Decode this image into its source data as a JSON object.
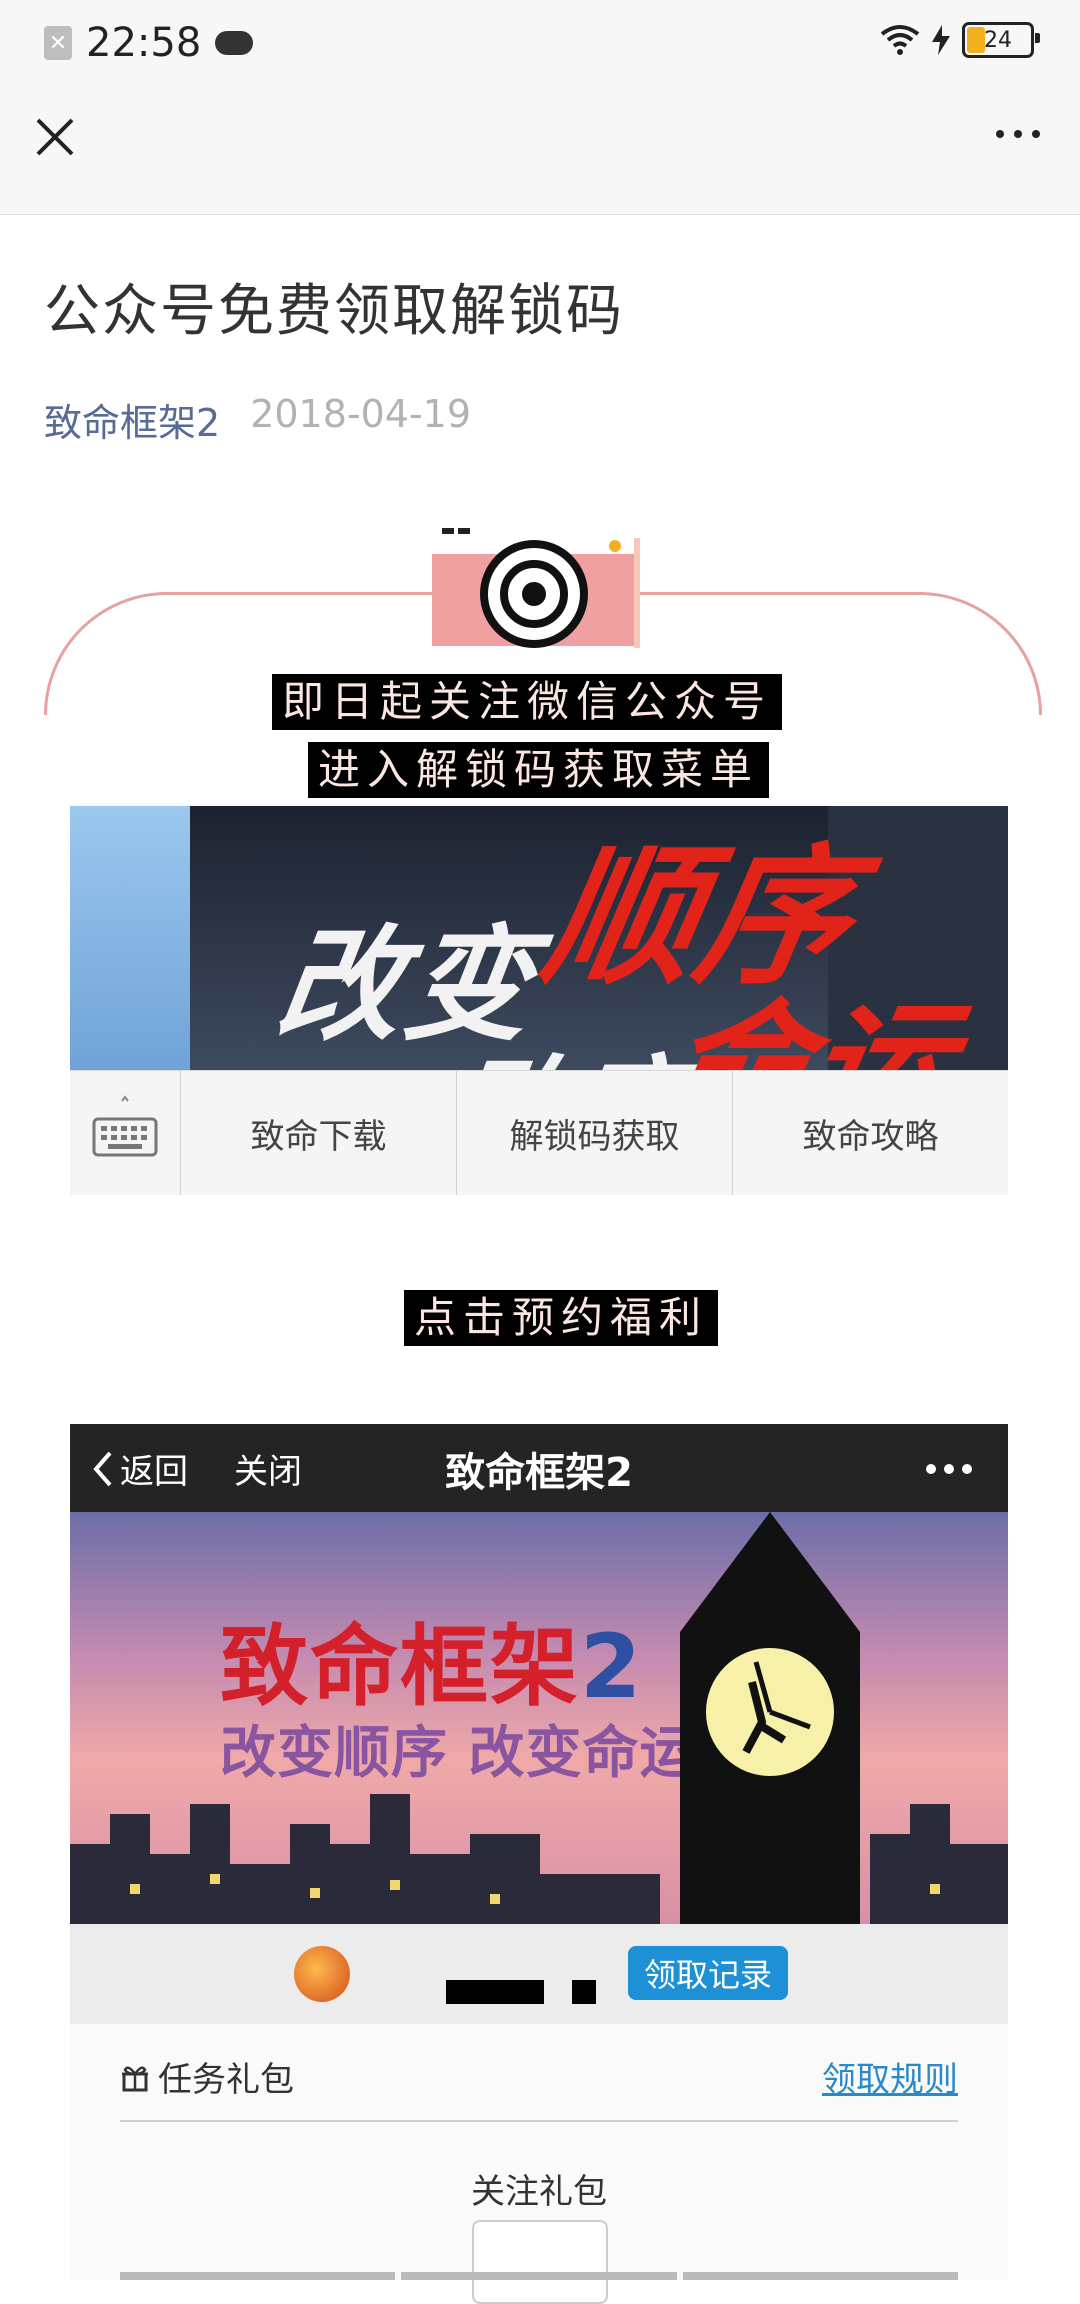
{
  "status_bar": {
    "time": "22:58",
    "battery": "24",
    "icons": [
      "notification-x-icon",
      "cloud-icon",
      "wifi-icon",
      "charging-icon",
      "battery-icon"
    ]
  },
  "nav": {
    "close_icon": "close-icon",
    "more_icon": "more-icon"
  },
  "article": {
    "title": "公众号免费领取解锁码",
    "author": "致命框架2",
    "date": "2018-04-19",
    "highlight_line1": "即日起关注微信公众号",
    "highlight_line2": "进入解锁码获取菜单",
    "highlight_line3": "点击预约福利"
  },
  "banner1": {
    "text_white_1": "改变",
    "text_red_1": "顺序",
    "text_white_2": "改变",
    "text_red_2": "命运"
  },
  "menu": {
    "items": [
      "致命下载",
      "解锁码获取",
      "致命攻略"
    ]
  },
  "app_screen": {
    "back_label": "返回",
    "close_label": "关闭",
    "title": "致命框架2",
    "banner_title_text": "致命框架",
    "banner_title_num": "2",
    "banner_subtitle": "改变顺序 改变命运",
    "record_button": "领取记录",
    "task_gift": "任务礼包",
    "rules_link": "领取规则",
    "follow_gift": "关注礼包"
  },
  "colors": {
    "author_link": "#576b95",
    "highlight_bg": "#000000",
    "highlight_text": "#fbe7df",
    "accent_red": "#e2231a",
    "record_blue": "#1e90d6"
  }
}
